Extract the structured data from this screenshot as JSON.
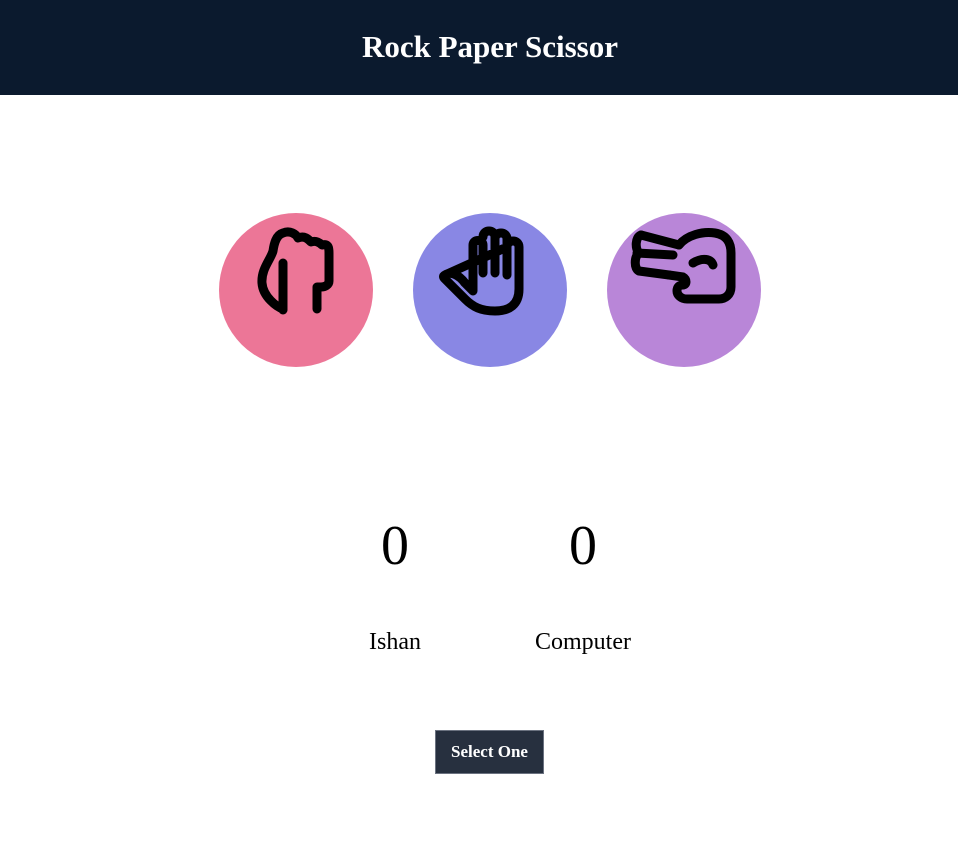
{
  "header": {
    "title": "Rock Paper Scissor"
  },
  "choices": [
    {
      "id": "rock",
      "icon": "fist-icon",
      "color": "#ec7697"
    },
    {
      "id": "paper",
      "icon": "open-hand-icon",
      "color": "#8987e4"
    },
    {
      "id": "scissor",
      "icon": "scissors-hand-icon",
      "color": "#b986d8"
    }
  ],
  "scoreboard": {
    "user": {
      "score": "0",
      "name": "Ishan"
    },
    "computer": {
      "score": "0",
      "name": "Computer"
    }
  },
  "message": {
    "text": "Select One",
    "background": "#27303f"
  },
  "colors": {
    "header_background": "#0b1a2e"
  }
}
